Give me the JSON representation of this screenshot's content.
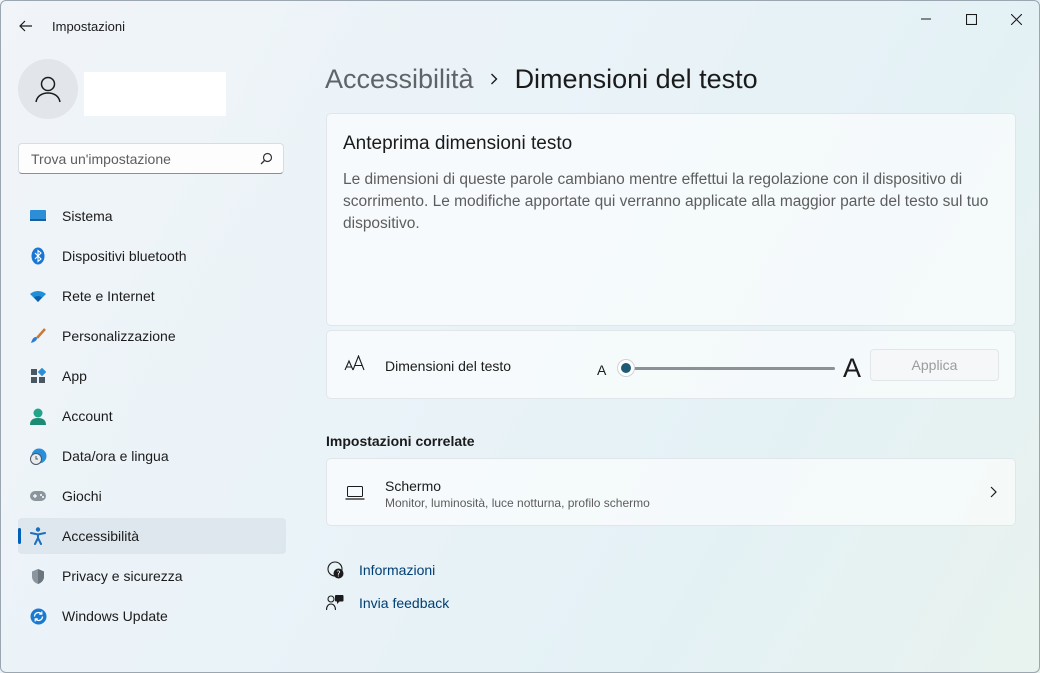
{
  "app": {
    "title": "Impostazioni",
    "back_icon": "arrow-left-icon",
    "window_controls": [
      "minimize-icon",
      "maximize-icon",
      "close-icon"
    ]
  },
  "sidebar": {
    "user_name": "",
    "search": {
      "placeholder": "Trova un'impostazione",
      "value": ""
    },
    "items": [
      {
        "label": "Sistema",
        "icon": "monitor-icon",
        "active": false
      },
      {
        "label": "Dispositivi bluetooth",
        "icon": "bluetooth-icon",
        "active": false
      },
      {
        "label": "Rete e Internet",
        "icon": "wifi-icon",
        "active": false
      },
      {
        "label": "Personalizzazione",
        "icon": "paintbrush-icon",
        "active": false
      },
      {
        "label": "App",
        "icon": "apps-icon",
        "active": false
      },
      {
        "label": "Account",
        "icon": "account-icon",
        "active": false
      },
      {
        "label": "Data/ora e lingua",
        "icon": "clock-globe-icon",
        "active": false
      },
      {
        "label": "Giochi",
        "icon": "gamepad-icon",
        "active": false
      },
      {
        "label": "Accessibilità",
        "icon": "accessibility-icon",
        "active": true
      },
      {
        "label": "Privacy e sicurezza",
        "icon": "shield-icon",
        "active": false
      },
      {
        "label": "Windows Update",
        "icon": "update-icon",
        "active": false
      }
    ]
  },
  "main": {
    "breadcrumb": {
      "parent": "Accessibilità",
      "current": "Dimensioni del testo"
    },
    "preview": {
      "title": "Anteprima dimensioni testo",
      "text": "Le dimensioni di queste parole cambiano mentre effettui la regolazione con il dispositivo di scorrimento. Le modifiche apportate qui verranno applicate alla maggior parte del testo sul tuo dispositivo."
    },
    "text_size": {
      "label": "Dimensioni del testo",
      "icon": "text-size-icon",
      "min_label": "A",
      "max_label": "A",
      "value_fraction": 0,
      "apply_label": "Applica"
    },
    "related": {
      "title": "Impostazioni correlate",
      "screen": {
        "title": "Schermo",
        "subtitle": "Monitor, luminosità, luce notturna, profilo schermo",
        "icon": "laptop-icon"
      }
    },
    "links": [
      {
        "label": "Informazioni",
        "icon": "help-icon"
      },
      {
        "label": "Invia feedback",
        "icon": "feedback-icon"
      }
    ]
  },
  "colors": {
    "accent": "#005fb8",
    "slider_thumb": "#1d5b74",
    "link": "#003e73"
  }
}
